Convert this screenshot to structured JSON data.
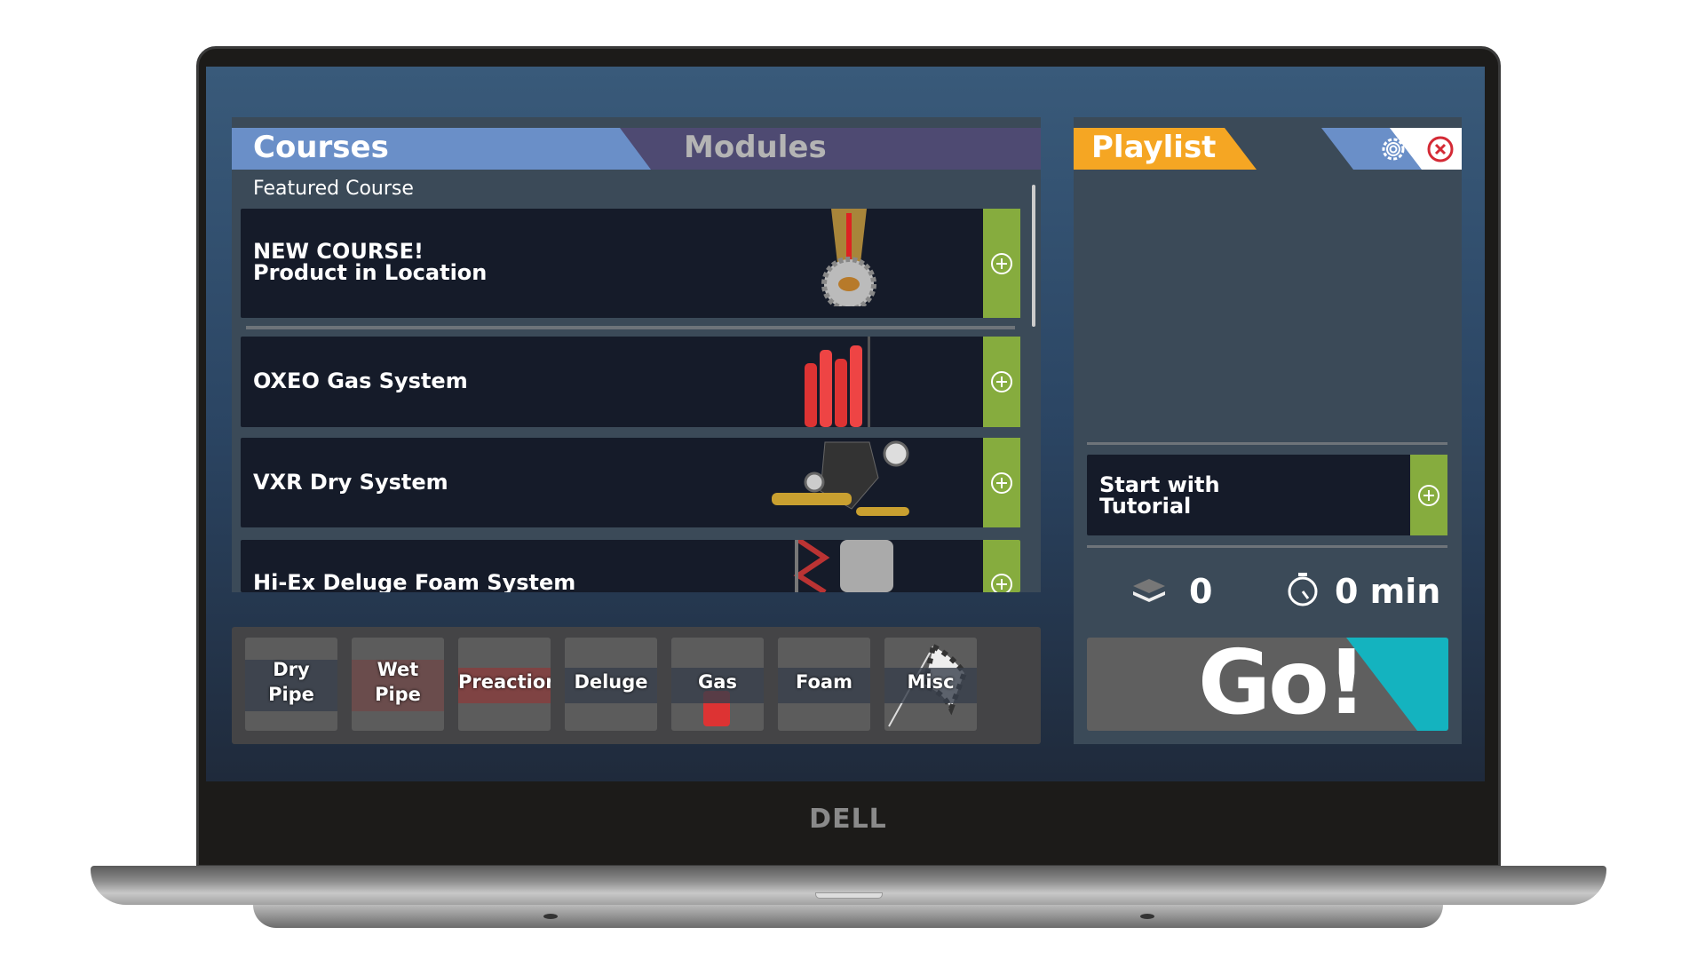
{
  "brand": "DELL",
  "tabs": {
    "courses": "Courses",
    "modules": "Modules"
  },
  "section_label": "Featured Course",
  "courses": [
    {
      "title": "NEW COURSE! Product in Location",
      "icon": "sprinkler-image"
    },
    {
      "title": "OXEO Gas System",
      "icon": "gas-cylinders-image"
    },
    {
      "title": "VXR Dry System",
      "icon": "dry-valve-image"
    },
    {
      "title": "Hi-Ex Deluge Foam System",
      "icon": "foam-system-image"
    }
  ],
  "categories": [
    {
      "l1": "Dry",
      "l2": "Pipe"
    },
    {
      "l1": "Wet",
      "l2": "Pipe"
    },
    {
      "l1": "Preaction"
    },
    {
      "l1": "Deluge"
    },
    {
      "l1": "Gas"
    },
    {
      "l1": "Foam"
    },
    {
      "l1": "Misc"
    }
  ],
  "playlist": {
    "title": "Playlist",
    "tutorial": "Start with Tutorial",
    "count": "0",
    "duration": "0 min",
    "go": "Go!"
  },
  "colors": {
    "courses_tab": "#6a8fc8",
    "modules_tab": "#4e4a72",
    "playlist_tab": "#f5a623",
    "add": "#86ac3e",
    "go_accent": "#14b3bf"
  }
}
